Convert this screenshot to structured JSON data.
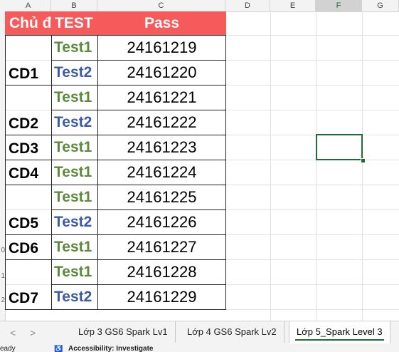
{
  "columns": [
    "A",
    "B",
    "C",
    "D",
    "E",
    "F",
    "G"
  ],
  "row_numbers": [
    "0",
    "1",
    "2"
  ],
  "table": {
    "header": {
      "topic": "Chủ đề",
      "test": "TEST",
      "pass": "Pass"
    },
    "rows": [
      {
        "test": "Test1",
        "pass": "24161219"
      },
      {
        "test": "Test2",
        "pass": "24161220"
      },
      {
        "test": "Test1",
        "pass": "24161221"
      },
      {
        "test": "Test2",
        "pass": "24161222"
      },
      {
        "test": "Test1",
        "pass": "24161223"
      },
      {
        "test": "Test1",
        "pass": "24161224"
      },
      {
        "test": "Test1",
        "pass": "24161225"
      },
      {
        "test": "Test2",
        "pass": "24161226"
      },
      {
        "test": "Test1",
        "pass": "24161227"
      },
      {
        "test": "Test1",
        "pass": "24161228"
      },
      {
        "test": "Test2",
        "pass": "24161229"
      }
    ],
    "topics": [
      "CD1",
      "CD2",
      "CD3",
      "CD4",
      "CD5",
      "CD6",
      "CD7"
    ]
  },
  "sheet_tabs": {
    "nav_prev": "<",
    "nav_next": ">",
    "tabs": [
      "Lớp 3 GS6 Spark Lv1",
      "Lớp 4 GS6 Spark Lv2",
      "Lớp 5_Spark Level 3"
    ],
    "active_tab": "Lớp 5_Spark Level 3"
  },
  "status_bar": {
    "ready": "eady",
    "accessibility": "Accessibility: Investigate"
  },
  "colors": {
    "header_fill": "#f65a5a",
    "test1": "#5a8a3a",
    "test2": "#3b5ba5",
    "selection": "#1e6b37"
  }
}
